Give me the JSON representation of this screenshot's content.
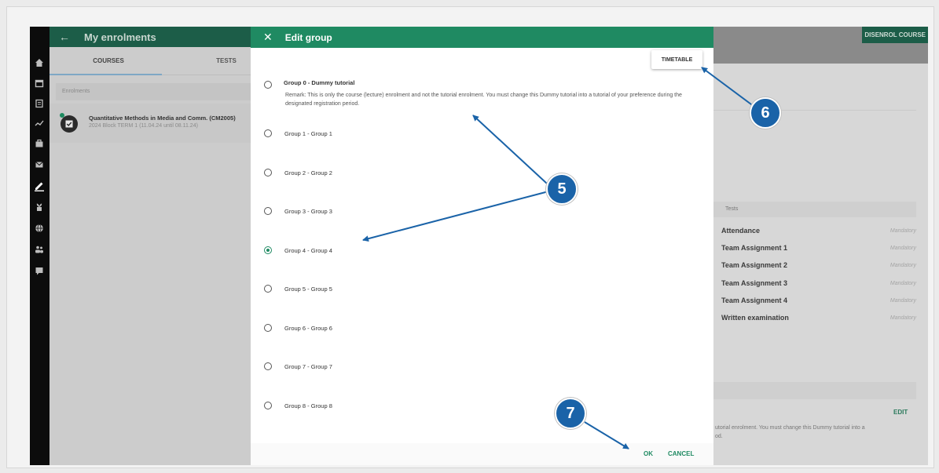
{
  "left_panel": {
    "title": "My enrolments",
    "tabs": [
      "COURSES",
      "TESTS"
    ],
    "section_label": "Enrolments",
    "course": {
      "name": "Quantitative Methods in Media and Comm. (CM2005)",
      "dates": "2024 Block TERM 1 (11.04.24 until 08.11.24)"
    }
  },
  "right_panel": {
    "disenrol_label": "DISENROL COURSE",
    "tests_header": "Tests",
    "tests": [
      {
        "name": "Attendance",
        "status": "Mandatory"
      },
      {
        "name": "Team Assignment 1",
        "status": "Mandatory"
      },
      {
        "name": "Team Assignment 2",
        "status": "Mandatory"
      },
      {
        "name": "Team Assignment 3",
        "status": "Mandatory"
      },
      {
        "name": "Team Assignment 4",
        "status": "Mandatory"
      },
      {
        "name": "Written examination",
        "status": "Mandatory"
      }
    ],
    "edit_label": "EDIT",
    "remark_fragment": "utorial enrolment. You must change this Dummy tutorial into a",
    "remark_fragment_2": "od."
  },
  "dialog": {
    "title": "Edit group",
    "timetable_label": "TIMETABLE",
    "groups": [
      {
        "label": "Group 0 - Dummy tutorial",
        "selected": false
      },
      {
        "label": "Group 1 - Group 1",
        "selected": false
      },
      {
        "label": "Group 2 - Group 2",
        "selected": false
      },
      {
        "label": "Group 3 - Group 3",
        "selected": false
      },
      {
        "label": "Group 4 - Group 4",
        "selected": true
      },
      {
        "label": "Group 5 - Group 5",
        "selected": false
      },
      {
        "label": "Group 6 - Group 6",
        "selected": false
      },
      {
        "label": "Group 7 - Group 7",
        "selected": false
      },
      {
        "label": "Group 8 - Group 8",
        "selected": false
      }
    ],
    "remark": "Remark: This is only the course (lecture) enrolment and not the tutorial enrolment. You must change this Dummy tutorial into a tutorial of your preference during the designated registration period.",
    "ok_label": "OK",
    "cancel_label": "CANCEL"
  },
  "annotations": {
    "badges": [
      "5",
      "6",
      "7"
    ],
    "arrow_color": "#1a63a8"
  },
  "colors": {
    "accent": "#1f8a62",
    "accent_dark": "#1c5d48",
    "badge": "#1a63a8"
  }
}
